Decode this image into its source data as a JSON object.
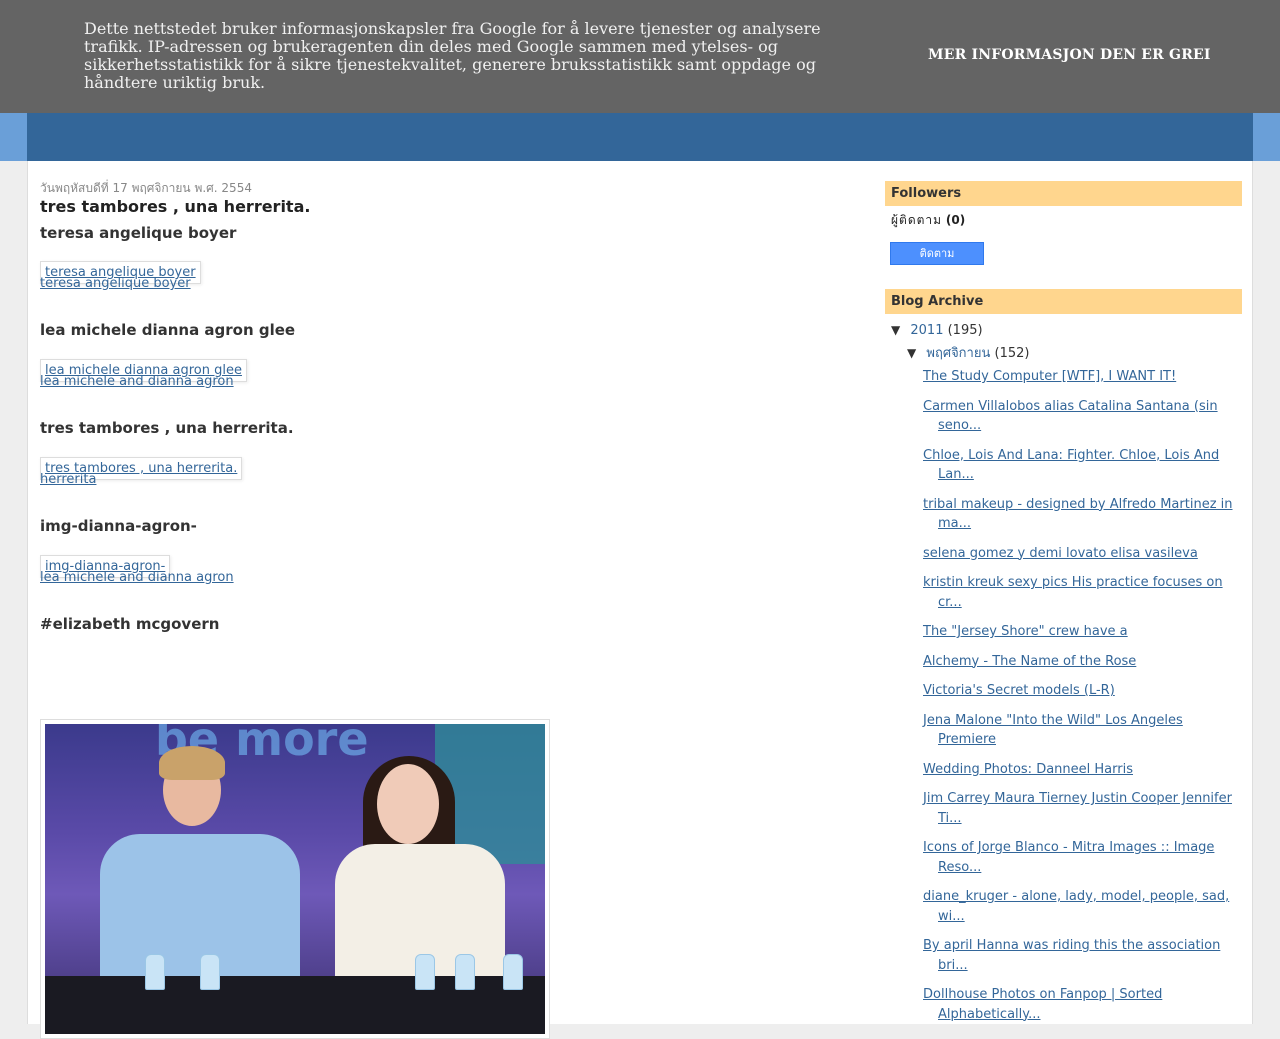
{
  "cookie_bar": {
    "text": "Dette nettstedet bruker informasjonskapsler fra Google for å levere tjenester og analysere trafikk. IP-adressen og brukeragenten din deles med Google sammen med ytelses- og sikkerhetsstatistikk for å sikre tjenestekvalitet, generere bruksstatistikk samt oppdage og håndtere uriktig bruk.",
    "more_label": "MER INFORMASJON",
    "ok_label": "DEN ER GREI"
  },
  "colors": {
    "header_blue": "#336699",
    "cookie_bg": "#646464",
    "widget_title_bg": "#ffd68e",
    "link": "#336699"
  },
  "post": {
    "date": "วันพฤหัสบดีที่ 17 พฤศจิกายน พ.ศ. 2554",
    "title": "tres tambores , una herrerita.",
    "subtitle": "teresa angelique boyer",
    "sections": [
      {
        "box_link": "teresa angelique boyer",
        "caption": "teresa angelique boyer"
      },
      {
        "heading": "lea michele dianna agron glee",
        "box_link": "lea michele dianna agron glee",
        "caption": "lea michele and dianna agron"
      },
      {
        "heading": "tres tambores , una herrerita.",
        "box_link": "tres tambores , una herrerita.",
        "caption": "herrerita"
      },
      {
        "heading": "img-dianna-agron-",
        "box_link": "img-dianna-agron-",
        "caption": "lea michele and dianna agron"
      },
      {
        "heading": "#elizabeth mcgovern"
      }
    ],
    "photo_stage_text": "be more"
  },
  "sidebar": {
    "followers": {
      "title": "Followers",
      "label": "ผู้ติดตาม",
      "count": "(0)",
      "button_label": "ติดตาม"
    },
    "archive": {
      "title": "Blog Archive",
      "year": "2011",
      "year_count": "(195)",
      "month": "พฤศจิกายน",
      "month_count": "(152)",
      "posts": [
        "The Study Computer [WTF], I WANT IT!",
        "Carmen Villalobos alias Catalina Santana (sin seno...",
        "Chloe, Lois And Lana: Fighter. Chloe, Lois And Lan...",
        "tribal makeup - designed by Alfredo Martinez in ma...",
        "selena gomez y demi lovato elisa vasileva",
        "kristin kreuk sexy pics His practice focuses on cr...",
        "The \"Jersey Shore\" crew have a",
        "Alchemy - The Name of the Rose",
        "Victoria's Secret models (L-R)",
        "Jena Malone \"Into the Wild\" Los Angeles Premiere",
        "Wedding Photos: Danneel Harris",
        "Jim Carrey Maura Tierney Justin Cooper Jennifer Ti...",
        "Icons of Jorge Blanco - Mitra Images :: Image Reso...",
        "diane_kruger - alone, lady, model, people, sad, wi...",
        "By april Hanna was riding this the association bri...",
        "Dollhouse Photos on Fanpop | Sorted Alphabetically..."
      ]
    }
  }
}
